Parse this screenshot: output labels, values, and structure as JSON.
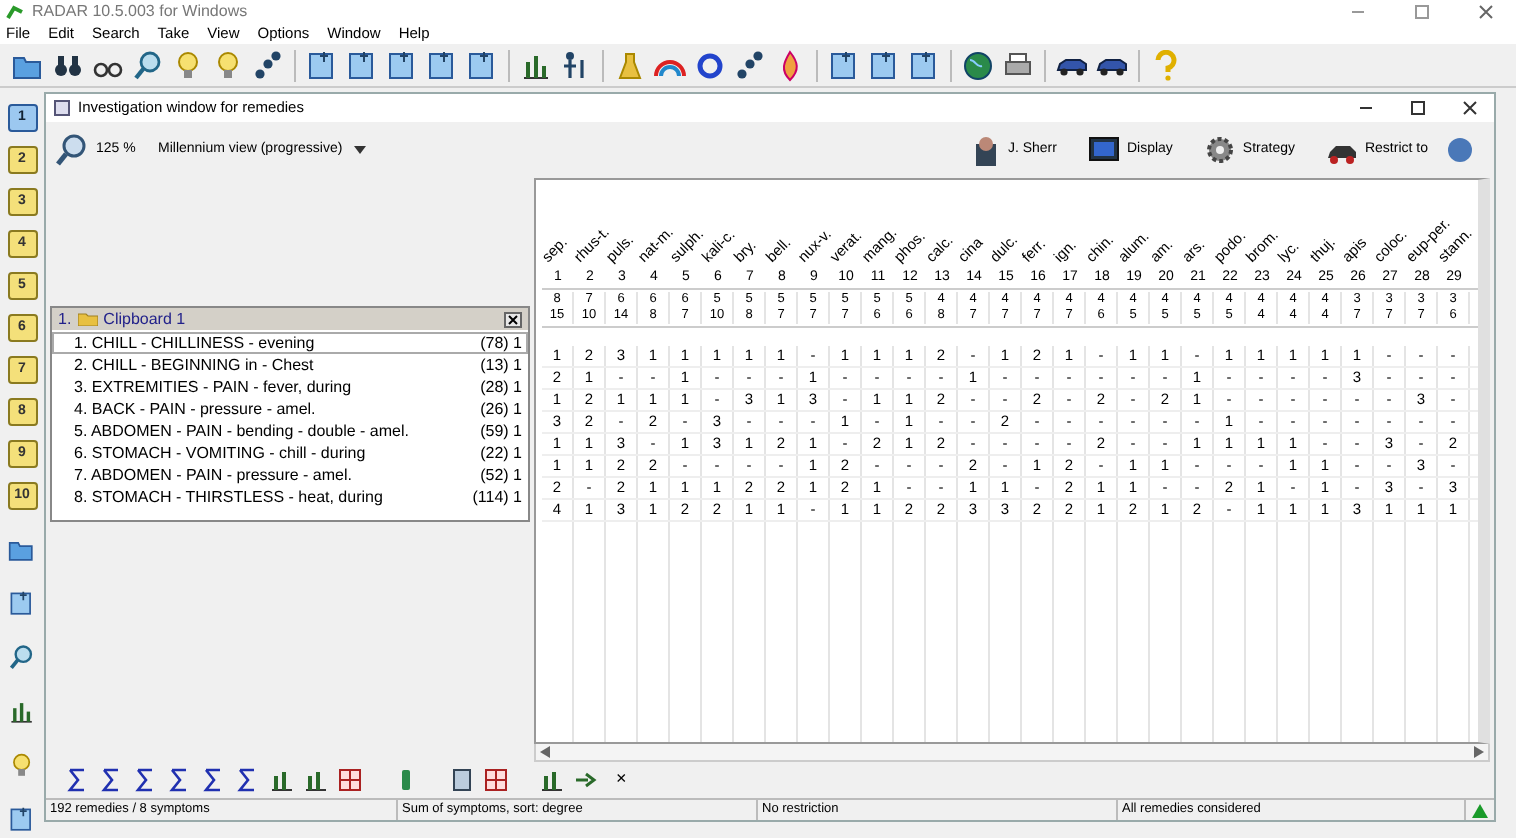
{
  "app_title": "RADAR 10.5.003 for Windows",
  "menu": [
    "File",
    "Edit",
    "Search",
    "Take",
    "View",
    "Options",
    "Window",
    "Help"
  ],
  "left_tabs": [
    {
      "label": "1",
      "selected": true
    },
    {
      "label": "2",
      "selected": false
    },
    {
      "label": "3",
      "selected": false
    },
    {
      "label": "4",
      "selected": false
    },
    {
      "label": "5",
      "selected": false
    },
    {
      "label": "6",
      "selected": false
    },
    {
      "label": "7",
      "selected": false
    },
    {
      "label": "8",
      "selected": false
    },
    {
      "label": "9",
      "selected": false
    },
    {
      "label": "10",
      "selected": false
    }
  ],
  "child_window": {
    "title": "Investigation window for remedies",
    "zoom": "125 %",
    "view": "Millennium view (progressive)",
    "buttons": [
      "J. Sherr",
      "Display",
      "Strategy",
      "Restrict to"
    ]
  },
  "clipboard": {
    "number": "1.",
    "name": "Clipboard 1",
    "rubrics": [
      {
        "label": "1. CHILL - CHILLINESS - evening",
        "count": "(78) 1",
        "selected": true
      },
      {
        "label": "2. CHILL - BEGINNING in - Chest",
        "count": "(13) 1",
        "selected": false
      },
      {
        "label": "3. EXTREMITIES - PAIN - fever, during",
        "count": "(28) 1",
        "selected": false
      },
      {
        "label": "4. BACK - PAIN - pressure - amel.",
        "count": "(26) 1",
        "selected": false
      },
      {
        "label": "5. ABDOMEN - PAIN - bending - double - amel.",
        "count": "(59) 1",
        "selected": false
      },
      {
        "label": "6. STOMACH - VOMITING - chill - during",
        "count": "(22) 1",
        "selected": false
      },
      {
        "label": "7. ABDOMEN - PAIN - pressure - amel.",
        "count": "(52) 1",
        "selected": false
      },
      {
        "label": "8. STOMACH - THIRSTLESS - heat, during",
        "count": "(114) 1",
        "selected": false
      }
    ]
  },
  "remedies": [
    {
      "name": "sep.",
      "rank": "1",
      "symptoms": "8",
      "degree": "15"
    },
    {
      "name": "rhus-t.",
      "rank": "2",
      "symptoms": "7",
      "degree": "10"
    },
    {
      "name": "puls.",
      "rank": "3",
      "symptoms": "6",
      "degree": "14"
    },
    {
      "name": "nat-m.",
      "rank": "4",
      "symptoms": "6",
      "degree": "8"
    },
    {
      "name": "sulph.",
      "rank": "5",
      "symptoms": "6",
      "degree": "7"
    },
    {
      "name": "kali-c.",
      "rank": "6",
      "symptoms": "5",
      "degree": "10"
    },
    {
      "name": "bry.",
      "rank": "7",
      "symptoms": "5",
      "degree": "8"
    },
    {
      "name": "bell.",
      "rank": "8",
      "symptoms": "5",
      "degree": "7"
    },
    {
      "name": "nux-v.",
      "rank": "9",
      "symptoms": "5",
      "degree": "7"
    },
    {
      "name": "verat.",
      "rank": "10",
      "symptoms": "5",
      "degree": "7"
    },
    {
      "name": "mang.",
      "rank": "11",
      "symptoms": "5",
      "degree": "6"
    },
    {
      "name": "phos.",
      "rank": "12",
      "symptoms": "5",
      "degree": "6"
    },
    {
      "name": "calc.",
      "rank": "13",
      "symptoms": "4",
      "degree": "8"
    },
    {
      "name": "cina",
      "rank": "14",
      "symptoms": "4",
      "degree": "7"
    },
    {
      "name": "dulc.",
      "rank": "15",
      "symptoms": "4",
      "degree": "7"
    },
    {
      "name": "ferr.",
      "rank": "16",
      "symptoms": "4",
      "degree": "7"
    },
    {
      "name": "ign.",
      "rank": "17",
      "symptoms": "4",
      "degree": "7"
    },
    {
      "name": "chin.",
      "rank": "18",
      "symptoms": "4",
      "degree": "6"
    },
    {
      "name": "alum.",
      "rank": "19",
      "symptoms": "4",
      "degree": "5"
    },
    {
      "name": "am.",
      "rank": "20",
      "symptoms": "4",
      "degree": "5"
    },
    {
      "name": "ars.",
      "rank": "21",
      "symptoms": "4",
      "degree": "5"
    },
    {
      "name": "podo.",
      "rank": "22",
      "symptoms": "4",
      "degree": "5"
    },
    {
      "name": "brom.",
      "rank": "23",
      "symptoms": "4",
      "degree": "4"
    },
    {
      "name": "lyc.",
      "rank": "24",
      "symptoms": "4",
      "degree": "4"
    },
    {
      "name": "thuj.",
      "rank": "25",
      "symptoms": "4",
      "degree": "4"
    },
    {
      "name": "apis",
      "rank": "26",
      "symptoms": "3",
      "degree": "7"
    },
    {
      "name": "coloc.",
      "rank": "27",
      "symptoms": "3",
      "degree": "7"
    },
    {
      "name": "eup-per.",
      "rank": "28",
      "symptoms": "3",
      "degree": "7"
    },
    {
      "name": "stann.",
      "rank": "29",
      "symptoms": "3",
      "degree": "6"
    }
  ],
  "grid_rows": [
    [
      "1",
      "2",
      "3",
      "1",
      "1",
      "1",
      "1",
      "1",
      "-",
      "1",
      "1",
      "1",
      "2",
      "-",
      "1",
      "2",
      "1",
      "-",
      "1",
      "1",
      "-",
      "1",
      "1",
      "1",
      "1",
      "1",
      "-",
      "-",
      "-"
    ],
    [
      "2",
      "1",
      "-",
      "-",
      "1",
      "-",
      "-",
      "-",
      "1",
      "-",
      "-",
      "-",
      "-",
      "1",
      "-",
      "-",
      "-",
      "-",
      "-",
      "-",
      "1",
      "-",
      "-",
      "-",
      "-",
      "3",
      "-",
      "-",
      "-"
    ],
    [
      "1",
      "2",
      "1",
      "1",
      "1",
      "-",
      "3",
      "1",
      "3",
      "-",
      "1",
      "1",
      "2",
      "-",
      "-",
      "2",
      "-",
      "2",
      "-",
      "2",
      "1",
      "-",
      "-",
      "-",
      "-",
      "-",
      "-",
      "3",
      "-"
    ],
    [
      "3",
      "2",
      "-",
      "2",
      "-",
      "3",
      "-",
      "-",
      "-",
      "1",
      "-",
      "1",
      "-",
      "-",
      "2",
      "-",
      "-",
      "-",
      "-",
      "-",
      "-",
      "1",
      "-",
      "-",
      "-",
      "-",
      "-",
      "-",
      "-"
    ],
    [
      "1",
      "1",
      "3",
      "-",
      "1",
      "3",
      "1",
      "2",
      "1",
      "-",
      "2",
      "1",
      "2",
      "-",
      "-",
      "-",
      "-",
      "2",
      "-",
      "-",
      "1",
      "1",
      "1",
      "1",
      "-",
      "-",
      "3",
      "-",
      "2"
    ],
    [
      "1",
      "1",
      "2",
      "2",
      "-",
      "-",
      "-",
      "-",
      "1",
      "2",
      "-",
      "-",
      "-",
      "2",
      "-",
      "1",
      "2",
      "-",
      "1",
      "1",
      "-",
      "-",
      "-",
      "1",
      "1",
      "-",
      "-",
      "3",
      "-"
    ],
    [
      "2",
      "-",
      "2",
      "1",
      "1",
      "1",
      "2",
      "2",
      "1",
      "2",
      "1",
      "-",
      "-",
      "1",
      "1",
      "-",
      "2",
      "1",
      "1",
      "-",
      "-",
      "2",
      "1",
      "-",
      "1",
      "-",
      "3",
      "-",
      "3"
    ],
    [
      "4",
      "1",
      "3",
      "1",
      "2",
      "2",
      "1",
      "1",
      "-",
      "1",
      "1",
      "2",
      "2",
      "3",
      "3",
      "2",
      "2",
      "1",
      "2",
      "1",
      "2",
      "-",
      "1",
      "1",
      "1",
      "3",
      "1",
      "1",
      "1"
    ]
  ],
  "bottom_close": "×",
  "status_bar": [
    "192 remedies / 8 symptoms",
    "Sum of symptoms, sort: degree",
    "No restriction",
    "All remedies considered"
  ]
}
